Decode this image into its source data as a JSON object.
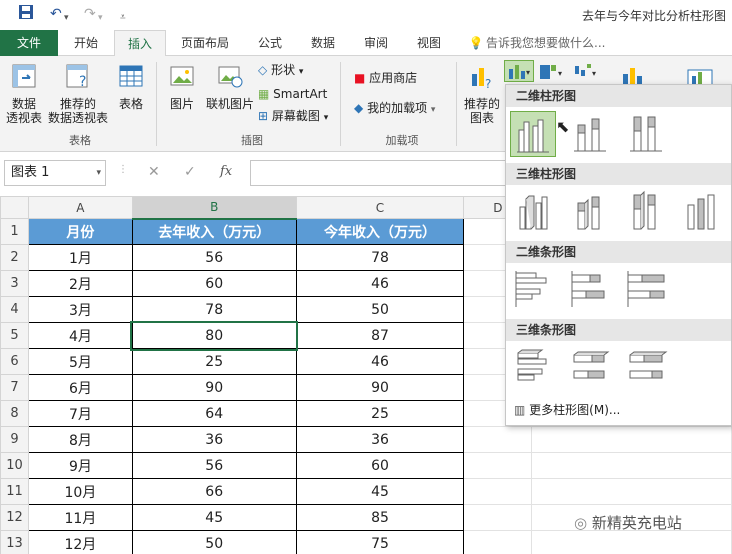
{
  "qat": {
    "save_icon": "save-icon",
    "undo_icon": "undo-icon",
    "redo_icon": "redo-icon",
    "customize_icon": "customize-icon"
  },
  "window_title": "去年与今年对比分析柱形图",
  "tabs": [
    "文件",
    "开始",
    "插入",
    "页面布局",
    "公式",
    "数据",
    "审阅",
    "视图"
  ],
  "tell_me": "告诉我您想要做什么...",
  "ribbon": {
    "pivot": "数据\n透视表",
    "recommended_pivot": "推荐的\n数据透视表",
    "table": "表格",
    "group_table": "表格",
    "picture": "图片",
    "online_picture": "联机图片",
    "shapes": "形状",
    "smartart": "SmartArt",
    "screenshot": "屏幕截图",
    "group_illustrations": "插图",
    "store": "应用商店",
    "my_addins": "我的加载项",
    "group_addins": "加载项",
    "recommended_charts": "推荐的\n图表"
  },
  "formula": {
    "namebox": "图表 1",
    "cancel": "✕",
    "enter": "✓",
    "fx": "fx"
  },
  "columns": [
    "A",
    "B",
    "C",
    "D"
  ],
  "headers": [
    "月份",
    "去年收入（万元）",
    "今年收入（万元）"
  ],
  "rows": [
    [
      "1月",
      "56",
      "78"
    ],
    [
      "2月",
      "60",
      "46"
    ],
    [
      "3月",
      "78",
      "50"
    ],
    [
      "4月",
      "80",
      "87"
    ],
    [
      "5月",
      "25",
      "46"
    ],
    [
      "6月",
      "90",
      "90"
    ],
    [
      "7月",
      "64",
      "25"
    ],
    [
      "8月",
      "36",
      "36"
    ],
    [
      "9月",
      "56",
      "60"
    ],
    [
      "10月",
      "66",
      "45"
    ],
    [
      "11月",
      "45",
      "85"
    ],
    [
      "12月",
      "50",
      "75"
    ]
  ],
  "dropdown": {
    "sec1": "二维柱形图",
    "sec2": "三维柱形图",
    "sec3": "二维条形图",
    "sec4": "三维条形图",
    "more": "更多柱形图(M)..."
  },
  "watermark": "新精英充电站",
  "colors": {
    "accent": "#217346",
    "header_fill": "#5b9bd5"
  }
}
